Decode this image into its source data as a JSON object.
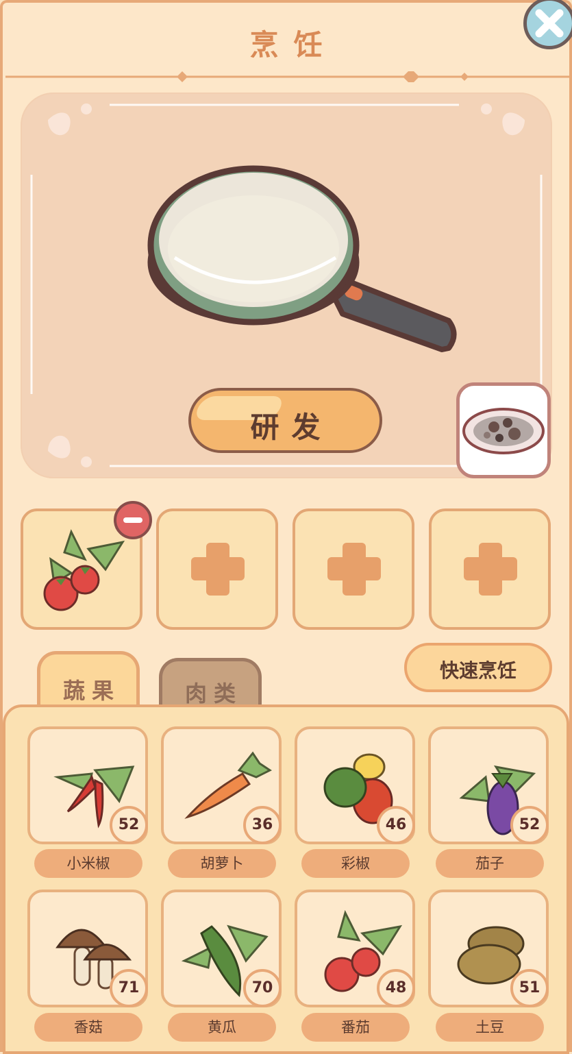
{
  "header": {
    "title": "烹饪"
  },
  "stage": {
    "develop_label": "研发"
  },
  "tabs": [
    {
      "label": "蔬果",
      "active": true
    },
    {
      "label": "肉类",
      "active": false
    }
  ],
  "quick_cook_label": "快速烹饪",
  "ingredients": [
    {
      "name": "小米椒",
      "count": "52",
      "icon": "chili-icon"
    },
    {
      "name": "胡萝卜",
      "count": "36",
      "icon": "carrot-icon"
    },
    {
      "name": "彩椒",
      "count": "46",
      "icon": "bell-pepper-icon"
    },
    {
      "name": "茄子",
      "count": "52",
      "icon": "eggplant-icon"
    },
    {
      "name": "香菇",
      "count": "71",
      "icon": "mushroom-icon"
    },
    {
      "name": "黄瓜",
      "count": "70",
      "icon": "cucumber-icon"
    },
    {
      "name": "番茄",
      "count": "48",
      "icon": "tomato-icon"
    },
    {
      "name": "土豆",
      "count": "51",
      "icon": "potato-icon"
    }
  ],
  "selected_slots": [
    "tomato-icon",
    "empty",
    "empty",
    "empty"
  ],
  "colors": {
    "accent": "#e7a978",
    "panel": "#fde7c9",
    "button": "#f4b66e",
    "text_dark": "#5d3c2f"
  }
}
